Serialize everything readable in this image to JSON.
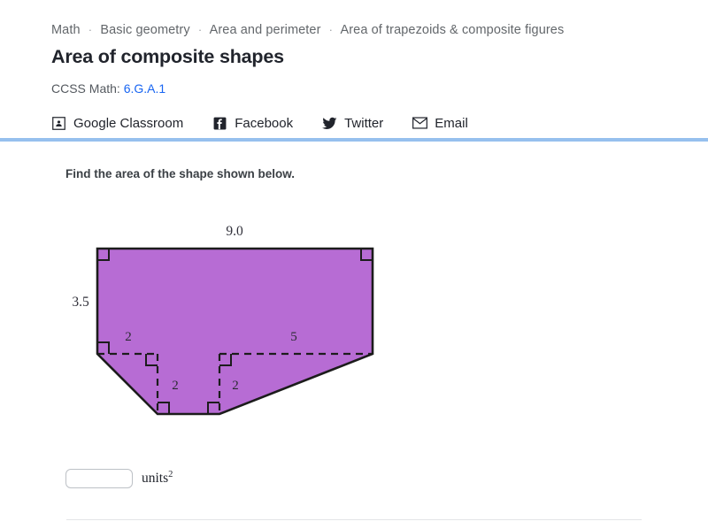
{
  "header": {
    "breadcrumb": {
      "separator": "·",
      "items": [
        {
          "label": "Math"
        },
        {
          "label": "Basic geometry"
        },
        {
          "label": "Area and perimeter"
        },
        {
          "label": "Area of trapezoids & composite figures"
        }
      ]
    },
    "title": "Area of composite shapes",
    "standard": {
      "prefix": "CCSS Math: ",
      "code": "6.G.A.1",
      "link_color": "#1865f2"
    },
    "share": [
      {
        "label": "Google Classroom",
        "icon": "google-classroom-icon"
      },
      {
        "label": "Facebook",
        "icon": "facebook-icon"
      },
      {
        "label": "Twitter",
        "icon": "twitter-icon"
      },
      {
        "label": "Email",
        "icon": "email-icon"
      }
    ],
    "rule_color": "#96c0ee"
  },
  "exercise": {
    "prompt": "Find the area of the shape shown below.",
    "answer": {
      "value": "",
      "placeholder": "",
      "units_text": "units",
      "units_exponent": "2"
    }
  },
  "figure": {
    "fill_color": "#b76cd4",
    "stroke_color": "#1c1c1c",
    "label_color": "#2b2b33",
    "labels": {
      "top": "9.0",
      "left": "3.5",
      "inner_left": "2",
      "inner_right": "5",
      "inner_mid_left": "2",
      "inner_mid_right": "2"
    }
  }
}
